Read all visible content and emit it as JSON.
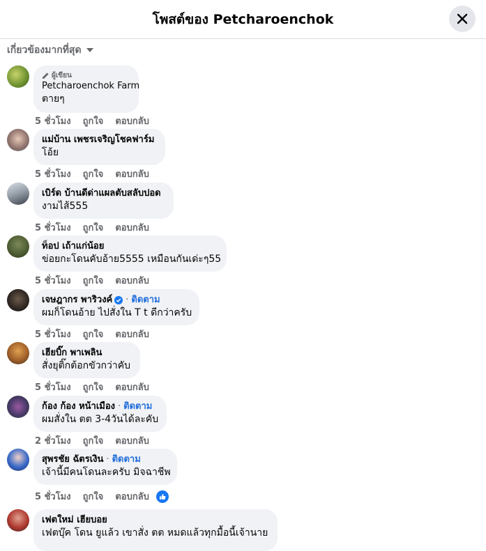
{
  "header": {
    "title": "โพสต์ของ Petcharoenchok"
  },
  "sort": {
    "label": "เกี่ยวข้องมากที่สุด"
  },
  "author_badge": "ผู้เขียน",
  "actions": {
    "like": "ถูกใจ",
    "reply": "ตอบกลับ"
  },
  "follow_label": "ติดตาม",
  "comments": [
    {
      "name": "Petcharoenchok Farm",
      "text": "ตายๆ",
      "time": "5 ชั่วโมง"
    },
    {
      "name": "แม่บ้าน เพชรเจริญโชคฟาร์ม",
      "text": "โอ้ย",
      "time": "5 ชั่วโมง"
    },
    {
      "name": "เบิร์ด บ้านดีด่าแผลตับสลับปอด",
      "text": "งามไส้555",
      "time": "5 ชั่วโมง"
    },
    {
      "name": "ท็อป เถ้าแก่น้อย",
      "text": "ข่อยกะโดนคับอ้าย5555 เหมือนกันเด่ะๆ55",
      "time": "5 ชั่วโมง"
    },
    {
      "name": "เจษฎากร พาริวงค์",
      "text": "ผมก็โดนอ้าย ไปสั่งใน T t ดีกว่าครับ",
      "time": "5 ชั่วโมง"
    },
    {
      "name": "เฮียบิ๊ก พาเพลิน",
      "text": "สั่งยุติ๊กต้อกขัวกว่าคับ",
      "time": "5 ชั่วโมง"
    },
    {
      "name": "ก้อง ก้อง หน้าเมือง",
      "text": "ผมสั่งใน ตต 3-4วันได้ละคับ",
      "time": "2 ชั่วโมง"
    },
    {
      "name": "สุพรชัย ฉัตรเงิน",
      "text": "เจ้านี้มีคนโดนละครับ มิจฉาชีพ",
      "time": "5 ชั่วโมง"
    },
    {
      "name": "เฟตใหม่ เฮียบอย",
      "text": "เฟตบุ๊ค โดน ยูแล้ว เขาสั่ง ตต หมดแล้วทุกมื้อนี้เจ้านาย",
      "time": ""
    }
  ],
  "colors": {
    "accent": "#1877f2",
    "follow": "#216fdb",
    "bubble": "#f0f2f5",
    "meta": "#65676b"
  },
  "icons": {
    "close": "close-icon",
    "sort": "chevron-down-icon",
    "author": "pencil-icon",
    "verified": "verified-icon",
    "like": "like-icon"
  }
}
